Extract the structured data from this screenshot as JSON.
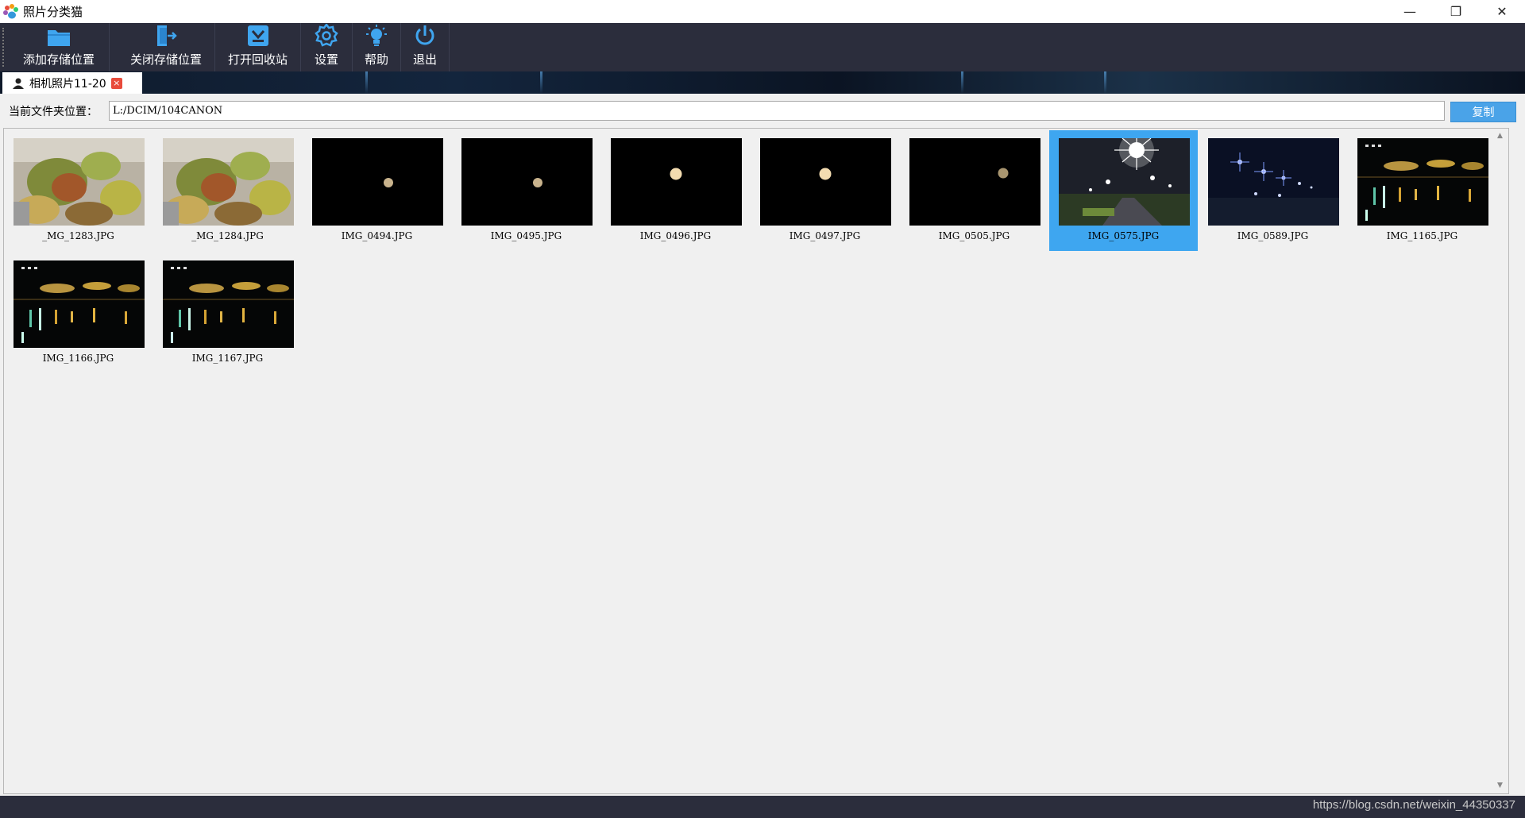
{
  "window": {
    "title": "照片分类猫",
    "minimize_glyph": "—",
    "restore_glyph": "❐",
    "close_glyph": "✕"
  },
  "toolbar": {
    "items": [
      {
        "label": "添加存储位置",
        "icon": "folder-add-icon"
      },
      {
        "label": "关闭存储位置",
        "icon": "door-exit-icon"
      },
      {
        "label": "打开回收站",
        "icon": "recycle-bin-icon"
      },
      {
        "label": "设置",
        "icon": "gear-icon"
      },
      {
        "label": "帮助",
        "icon": "lightbulb-icon"
      },
      {
        "label": "退出",
        "icon": "power-icon"
      }
    ],
    "icon_color": "#3fa5ef",
    "background": "#2b2d3c"
  },
  "tab": {
    "label": "相机照片11-20",
    "close_glyph": "×"
  },
  "path_bar": {
    "label": "当前文件夹位置：",
    "value": "L:/DCIM/104CANON",
    "copy_button": "复制"
  },
  "thumbnails": [
    {
      "name": "_MG_1283.JPG",
      "kind": "plant",
      "selected": false
    },
    {
      "name": "_MG_1284.JPG",
      "kind": "plant",
      "selected": false
    },
    {
      "name": "IMG_0494.JPG",
      "kind": "moon-small",
      "selected": false
    },
    {
      "name": "IMG_0495.JPG",
      "kind": "moon-small",
      "selected": false
    },
    {
      "name": "IMG_0496.JPG",
      "kind": "moon-bright",
      "selected": false
    },
    {
      "name": "IMG_0497.JPG",
      "kind": "moon-bright",
      "selected": false
    },
    {
      "name": "IMG_0505.JPG",
      "kind": "moon-dim",
      "selected": false
    },
    {
      "name": "IMG_0575.JPG",
      "kind": "street-light",
      "selected": true
    },
    {
      "name": "IMG_0589.JPG",
      "kind": "star-lights",
      "selected": false
    },
    {
      "name": "IMG_1165.JPG",
      "kind": "night-lake",
      "selected": false
    },
    {
      "name": "IMG_1166.JPG",
      "kind": "night-lake",
      "selected": false
    },
    {
      "name": "IMG_1167.JPG",
      "kind": "night-lake",
      "selected": false
    }
  ],
  "selection_color": "#3ea6f0",
  "footer": {
    "watermark": "https://blog.csdn.net/weixin_44350337"
  }
}
